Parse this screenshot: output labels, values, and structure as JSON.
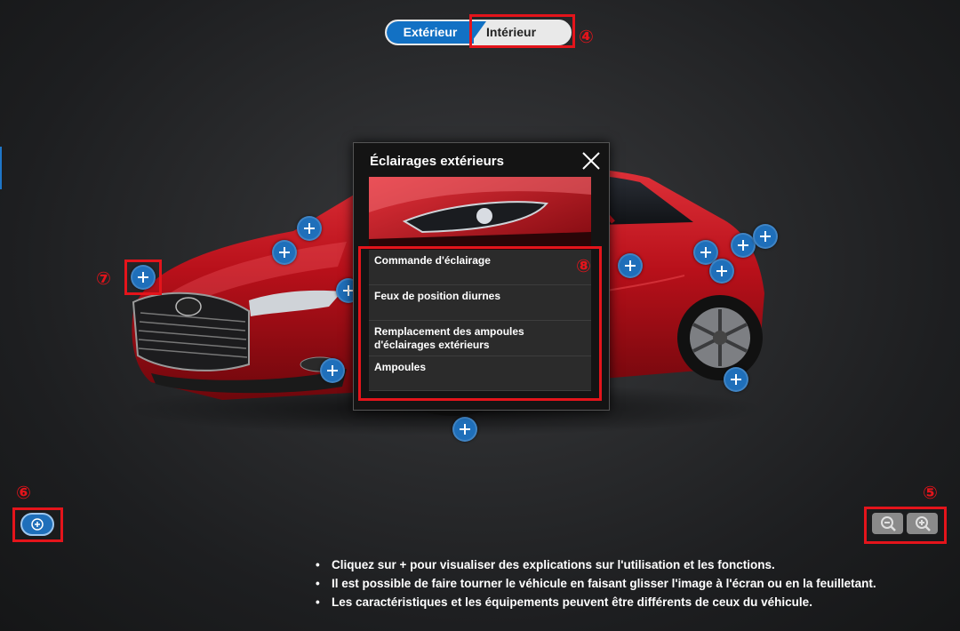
{
  "toggle": {
    "exterior_label": "Extérieur",
    "interior_label": "Intérieur"
  },
  "callouts": {
    "c4": "④",
    "c5": "⑤",
    "c6": "⑥",
    "c7": "⑦",
    "c8": "⑧"
  },
  "popup": {
    "title": "Éclairages extérieurs",
    "items": [
      {
        "label": "Commande d'éclairage"
      },
      {
        "label": "Feux de position diurnes"
      },
      {
        "label": "Remplacement des ampoules d'éclairages extérieurs"
      },
      {
        "label": "Ampoules"
      }
    ]
  },
  "notes": [
    "Cliquez sur + pour visualiser des explications sur l'utilisation et les fonctions.",
    "Il est possible de faire tourner le véhicule en faisant glisser l'image à l'écran ou en la feuilletant.",
    "Les caractéristiques et les équipements peuvent être différents de ceux du véhicule."
  ],
  "icons": {
    "hotspot": "plus-icon",
    "close": "close-icon",
    "zoom_out": "zoom-out-icon",
    "zoom_in": "zoom-in-icon",
    "rotate": "rotate-icon"
  },
  "colors": {
    "accent": "#1271c4",
    "highlight": "#e4141b",
    "car": "#c0141c"
  }
}
